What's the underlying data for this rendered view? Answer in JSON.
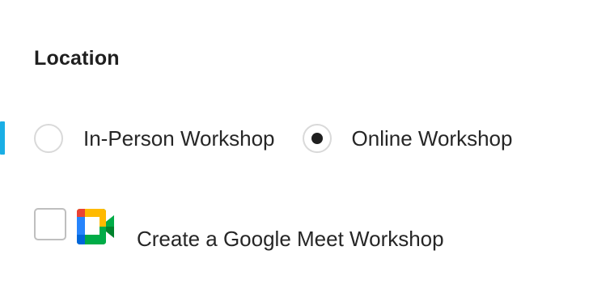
{
  "location": {
    "title": "Location",
    "options": [
      {
        "label": "In-Person Workshop",
        "selected": false
      },
      {
        "label": "Online Workshop",
        "selected": true
      }
    ]
  },
  "google_meet": {
    "label": "Create a Google Meet Workshop",
    "checked": false,
    "icon": "google-meet-icon"
  },
  "colors": {
    "focus_accent": "#1aaee5",
    "meet_blue": "#2684fc",
    "meet_green": "#00ac47",
    "meet_yellow": "#ffba00",
    "meet_red": "#ea4335",
    "meet_dark_green": "#00832d"
  }
}
